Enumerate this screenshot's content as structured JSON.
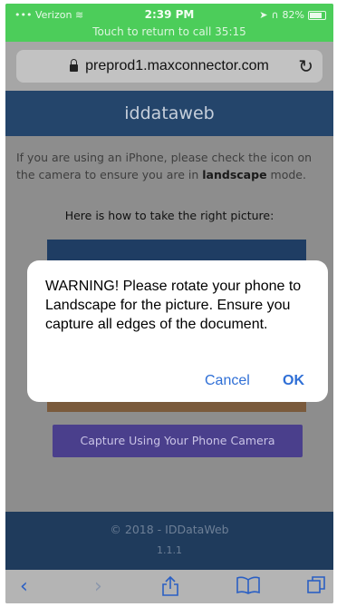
{
  "status_bar": {
    "carrier": "Verizon",
    "time": "2:39 PM",
    "battery": "82%",
    "call_banner": "Touch to return to call 35:15"
  },
  "browser": {
    "url": "preprod1.maxconnector.com"
  },
  "header": {
    "title": "iddataweb"
  },
  "content": {
    "intro_before": "If you are using an iPhone, please check the icon on the camera to ensure you are in ",
    "intro_bold": "landscape",
    "intro_after": " mode.",
    "howto": "Here is how to take the right picture:",
    "capture_button": "Capture Using Your Phone Camera"
  },
  "footer": {
    "copyright": "© 2018 - IDDataWeb",
    "version": "1.1.1"
  },
  "dialog": {
    "message": "WARNING! Please rotate your phone to Landscape for the picture. Ensure you capture all edges of the document.",
    "cancel_label": "Cancel",
    "ok_label": "OK"
  },
  "toolbar": {
    "icons": [
      "back-icon",
      "forward-icon",
      "share-icon",
      "bookmarks-icon",
      "tabs-icon"
    ]
  },
  "colors": {
    "status_bar_bg": "#4ccd5a",
    "header_bg": "#24456b",
    "capture_button_bg": "#4a3f8c",
    "dialog_button_text": "#2f6fd6"
  }
}
